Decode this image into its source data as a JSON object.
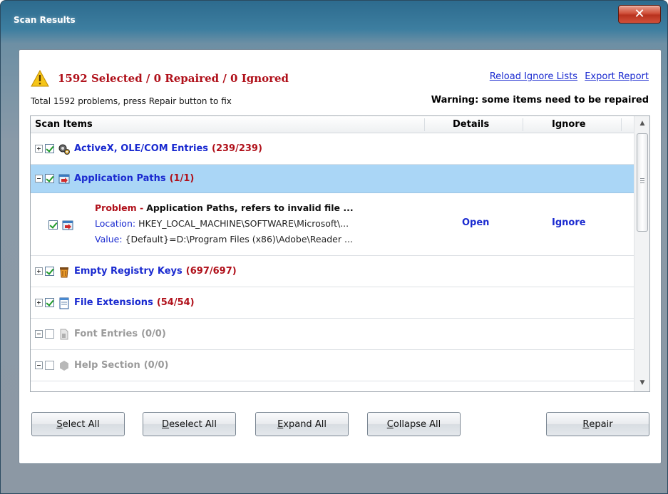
{
  "window": {
    "title": "Scan Results",
    "close_glyph": "✕"
  },
  "summary": {
    "selected_text": "1592 Selected / 0 Repaired / 0 Ignored",
    "subline": "Total 1592 problems, press Repair button to fix",
    "warning": "Warning: some items need to be repaired",
    "reload_link": "Reload Ignore Lists",
    "export_link": "Export Report",
    "icon": "warning-triangle-icon"
  },
  "list": {
    "headers": {
      "items": "Scan Items",
      "details": "Details",
      "ignore": "Ignore"
    },
    "rows": [
      {
        "name": "ActiveX, OLE/COM Entries",
        "count": "(239/239)",
        "expanded": false,
        "checked": true,
        "enabled": true,
        "icon": "gears-icon"
      },
      {
        "name": "Application Paths",
        "count": "(1/1)",
        "expanded": true,
        "checked": true,
        "enabled": true,
        "icon": "app-window-icon"
      },
      {
        "name": "Empty Registry Keys",
        "count": "(697/697)",
        "expanded": false,
        "checked": true,
        "enabled": true,
        "icon": "trash-icon"
      },
      {
        "name": "File Extensions",
        "count": "(54/54)",
        "expanded": false,
        "checked": true,
        "enabled": true,
        "icon": "document-icon"
      },
      {
        "name": "Font Entries",
        "count": "(0/0)",
        "expanded": true,
        "checked": false,
        "enabled": false,
        "icon": "font-file-icon"
      },
      {
        "name": "Help Section",
        "count": "(0/0)",
        "expanded": true,
        "checked": false,
        "enabled": false,
        "icon": "hexagon-icon"
      }
    ],
    "detail": {
      "problem_label": "Problem -",
      "problem_text": "Application Paths, refers to invalid file ...",
      "location_label": "Location:",
      "location_value": "HKEY_LOCAL_MACHINE\\SOFTWARE\\Microsoft\\...",
      "value_label": "Value:",
      "value_value": "{Default}=D:\\Program Files (x86)\\Adobe\\Reader ...",
      "open_label": "Open",
      "ignore_label": "Ignore"
    }
  },
  "buttons": {
    "select_all": {
      "accel": "S",
      "rest": "elect All"
    },
    "deselect_all": {
      "accel": "D",
      "rest": "eselect All"
    },
    "expand_all": {
      "accel": "E",
      "rest": "xpand All"
    },
    "collapse_all": {
      "accel": "C",
      "rest": "ollapse All"
    },
    "repair": {
      "accel": "R",
      "rest": "epair"
    }
  },
  "colors": {
    "accent_red": "#b0101a",
    "link_blue": "#1a2ad0",
    "selection": "#aad6f6"
  }
}
